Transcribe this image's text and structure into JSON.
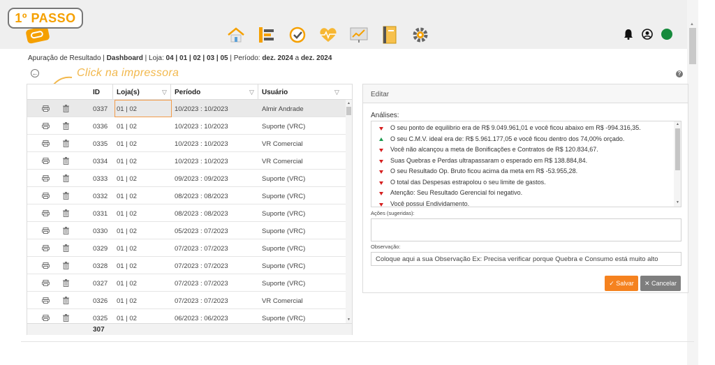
{
  "badge": {
    "label": "1º PASSO"
  },
  "hint": {
    "text": "Click na impressora"
  },
  "breadcrumb": {
    "p1": "Apuração de Resultado | ",
    "p2": "Dashboard",
    "p3": " | Loja: ",
    "p4": "04 | 01 | 02 | 03 | 05",
    "p5": " | Período: ",
    "p6": "dez. 2024",
    "p7": " a ",
    "p8": "dez. 2024"
  },
  "nav": {
    "icons": [
      "home-icon",
      "list-icon",
      "check-circle-icon",
      "heart-rate-icon",
      "chart-board-icon",
      "notebook-icon",
      "settings-gear-icon"
    ]
  },
  "colors": {
    "accent": "#f5a000",
    "status_ok": "#168a3c",
    "save": "#f5821f",
    "cancel": "#7e7e7e",
    "down": "#d62020",
    "up": "#1d9b50"
  },
  "grid": {
    "headers": {
      "id": "ID",
      "loja": "Loja(s)",
      "periodo": "Período",
      "usuario": "Usuário"
    },
    "rows": [
      {
        "id": "0337",
        "loja": "01 | 02",
        "periodo": "10/2023 : 10/2023",
        "usuario": "Almir Andrade"
      },
      {
        "id": "0336",
        "loja": "01 | 02",
        "periodo": "10/2023 : 10/2023",
        "usuario": "Suporte (VRC)"
      },
      {
        "id": "0335",
        "loja": "01 | 02",
        "periodo": "10/2023 : 10/2023",
        "usuario": "VR Comercial"
      },
      {
        "id": "0334",
        "loja": "01 | 02",
        "periodo": "10/2023 : 10/2023",
        "usuario": "VR Comercial"
      },
      {
        "id": "0333",
        "loja": "01 | 02",
        "periodo": "09/2023 : 09/2023",
        "usuario": "Suporte (VRC)"
      },
      {
        "id": "0332",
        "loja": "01 | 02",
        "periodo": "08/2023 : 08/2023",
        "usuario": "Suporte (VRC)"
      },
      {
        "id": "0331",
        "loja": "01 | 02",
        "periodo": "08/2023 : 08/2023",
        "usuario": "Suporte (VRC)"
      },
      {
        "id": "0330",
        "loja": "01 | 02",
        "periodo": "05/2023 : 07/2023",
        "usuario": "Suporte (VRC)"
      },
      {
        "id": "0329",
        "loja": "01 | 02",
        "periodo": "07/2023 : 07/2023",
        "usuario": "Suporte (VRC)"
      },
      {
        "id": "0328",
        "loja": "01 | 02",
        "periodo": "07/2023 : 07/2023",
        "usuario": "Suporte (VRC)"
      },
      {
        "id": "0327",
        "loja": "01 | 02",
        "periodo": "07/2023 : 07/2023",
        "usuario": "Suporte (VRC)"
      },
      {
        "id": "0326",
        "loja": "01 | 02",
        "periodo": "07/2023 : 07/2023",
        "usuario": "VR Comercial"
      },
      {
        "id": "0325",
        "loja": "01 | 02",
        "periodo": "06/2023 : 06/2023",
        "usuario": "Suporte (VRC)"
      }
    ],
    "footer_count": "307"
  },
  "panel": {
    "title": "Editar",
    "analises_label": "Análises:",
    "analises": [
      {
        "dir": "down",
        "text": "O seu ponto de equilibrio era de R$ 9.049.961,01 e você ficou abaixo em R$ -994.316,35."
      },
      {
        "dir": "up",
        "text": "O seu C.M.V. ideal era de: R$ 5.961.177,05 e você ficou dentro dos 74,00% orçado."
      },
      {
        "dir": "down",
        "text": "Você não alcançou a meta de Bonificações e Contratos de R$ 120.834,67."
      },
      {
        "dir": "down",
        "text": "Suas Quebras e Perdas ultrapassaram o esperado em R$ 138.884,84."
      },
      {
        "dir": "down",
        "text": "O seu Resultado Op. Bruto ficou acima da meta em R$ -53.955,28."
      },
      {
        "dir": "down",
        "text": "O total das Despesas estrapolou o seu limite de gastos."
      },
      {
        "dir": "down",
        "text": "Atenção: Seu Resultado Gerencial foi negativo."
      },
      {
        "dir": "down",
        "text": "Você possui Endividamento."
      }
    ],
    "acoes_label": "Ações (sugeridas):",
    "acoes_value": "",
    "obs_label": "Observação:",
    "obs_placeholder": "Coloque aqui a sua Observação Ex: Precisa verificar porque Quebra e Consumo está muito alto",
    "save_label": "Salvar",
    "cancel_label": "Cancelar"
  }
}
